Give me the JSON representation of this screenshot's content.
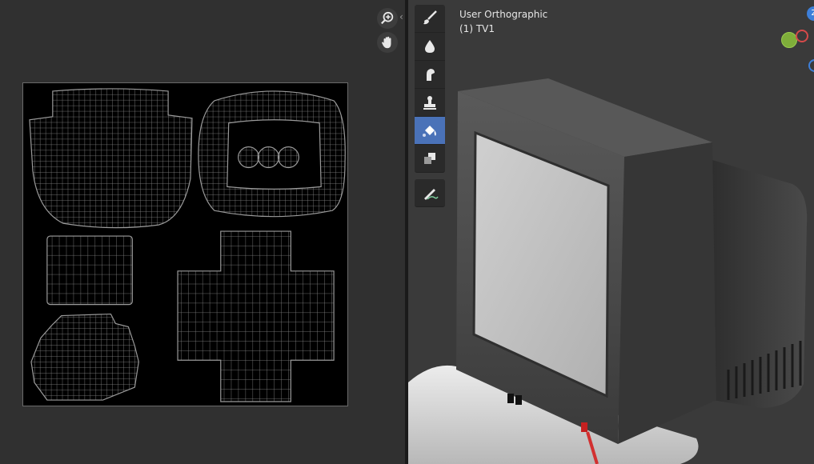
{
  "uv_editor": {
    "zoom_icon": "zoom-in-icon",
    "pan_icon": "hand-pan-icon",
    "collapse_glyph": "‹"
  },
  "viewport": {
    "view_name": "User Orthographic",
    "object_name": "(1) TV1",
    "tools": [
      {
        "name": "draw-brush-icon",
        "active": false
      },
      {
        "name": "soften-drop-icon",
        "active": false
      },
      {
        "name": "smear-icon",
        "active": false
      },
      {
        "name": "clone-stamp-icon",
        "active": false
      },
      {
        "name": "fill-bucket-icon",
        "active": true
      },
      {
        "name": "mask-icon",
        "active": false
      },
      {
        "name": "annotate-pen-icon",
        "active": false
      }
    ],
    "gizmo": {
      "z_label": "Z",
      "colors": {
        "x": "#d64a4a",
        "y": "#7fae3a",
        "z": "#3d7fd9"
      }
    }
  },
  "colors": {
    "active_tool": "#4a72b8",
    "uv_wire": "#8c8c8c"
  }
}
